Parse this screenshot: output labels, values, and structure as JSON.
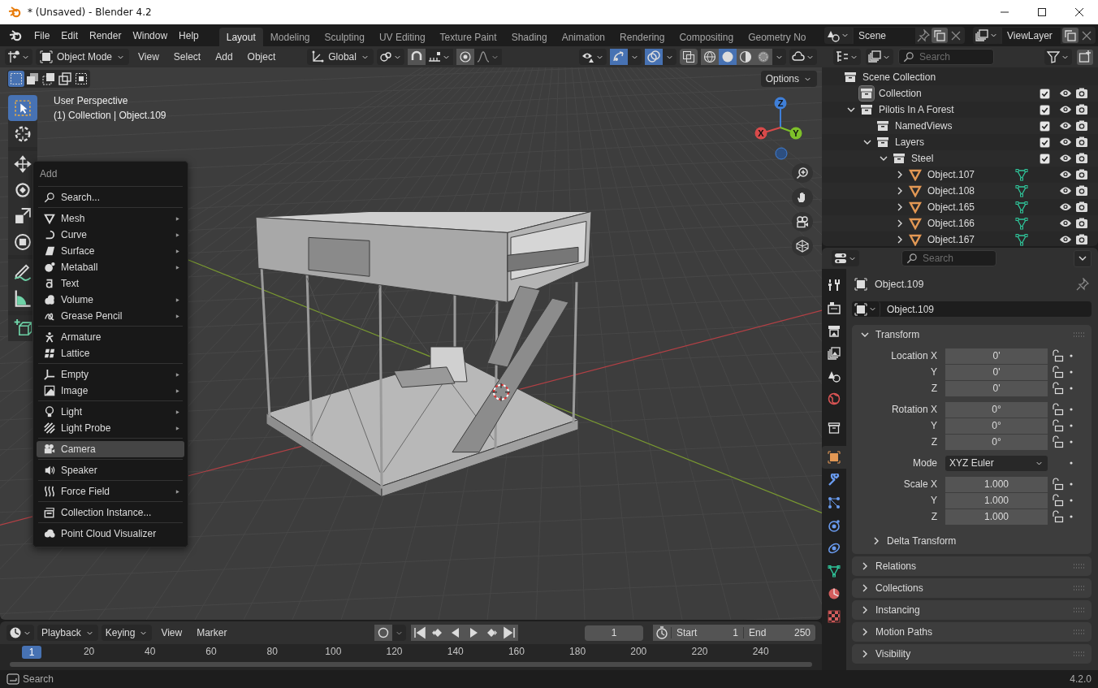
{
  "window": {
    "title": "* (Unsaved) - Blender 4.2"
  },
  "menu": [
    "File",
    "Edit",
    "Render",
    "Window",
    "Help"
  ],
  "workspaces": [
    {
      "label": "Layout",
      "selected": true
    },
    {
      "label": "Modeling",
      "selected": false
    },
    {
      "label": "Sculpting",
      "selected": false
    },
    {
      "label": "UV Editing",
      "selected": false
    },
    {
      "label": "Texture Paint",
      "selected": false
    },
    {
      "label": "Shading",
      "selected": false
    },
    {
      "label": "Animation",
      "selected": false
    },
    {
      "label": "Rendering",
      "selected": false
    },
    {
      "label": "Compositing",
      "selected": false
    },
    {
      "label": "Geometry No",
      "selected": false
    }
  ],
  "scene": {
    "name": "Scene"
  },
  "view_layer": {
    "name": "ViewLayer"
  },
  "viewport_header": {
    "mode": "Object Mode",
    "menus": [
      "View",
      "Select",
      "Add",
      "Object"
    ],
    "orientation": "Global",
    "gizmos_on": true,
    "overlays_on": true,
    "xray_on": false,
    "shading": [
      {
        "selected": false
      },
      {
        "selected": true
      },
      {
        "selected": false
      },
      {
        "selected": false
      }
    ]
  },
  "select_modes": [
    {
      "selected": true
    },
    {
      "selected": false
    },
    {
      "selected": false
    },
    {
      "selected": false
    },
    {
      "selected": false
    }
  ],
  "options": "Options",
  "tools": [
    {
      "kind": "select",
      "selected": true
    },
    {
      "kind": "cursor",
      "selected": false
    },
    {
      "kind": "move",
      "selected": false
    },
    {
      "kind": "rotate",
      "selected": false
    },
    {
      "kind": "scale",
      "selected": false
    },
    {
      "kind": "transform",
      "selected": false
    },
    {
      "kind": "annotate",
      "selected": false
    },
    {
      "kind": "measure",
      "selected": false
    },
    {
      "kind": "addcube",
      "selected": false
    }
  ],
  "viewport_info": {
    "perspective": "User Perspective",
    "context": "(1) Collection | Object.109"
  },
  "gizmo": {
    "z": "Z",
    "x": "X",
    "y": "Y"
  },
  "add_menu": {
    "title": "Add",
    "groups": [
      [
        {
          "kind": "search",
          "label": "Search...",
          "submenu": false,
          "selected": false
        }
      ],
      [
        {
          "kind": "mesh",
          "label": "Mesh",
          "submenu": true,
          "selected": false
        },
        {
          "kind": "curve",
          "label": "Curve",
          "submenu": true,
          "selected": false
        },
        {
          "kind": "surface",
          "label": "Surface",
          "submenu": true,
          "selected": false
        },
        {
          "kind": "metaball",
          "label": "Metaball",
          "submenu": true,
          "selected": false
        },
        {
          "kind": "text",
          "label": "Text",
          "submenu": false,
          "selected": false
        },
        {
          "kind": "volume",
          "label": "Volume",
          "submenu": true,
          "selected": false
        },
        {
          "kind": "grease",
          "label": "Grease Pencil",
          "submenu": true,
          "selected": false
        }
      ],
      [
        {
          "kind": "armature",
          "label": "Armature",
          "submenu": false,
          "selected": false
        },
        {
          "kind": "lattice",
          "label": "Lattice",
          "submenu": false,
          "selected": false
        }
      ],
      [
        {
          "kind": "empty",
          "label": "Empty",
          "submenu": true,
          "selected": false
        },
        {
          "kind": "image",
          "label": "Image",
          "submenu": true,
          "selected": false
        }
      ],
      [
        {
          "kind": "light",
          "label": "Light",
          "submenu": true,
          "selected": false
        },
        {
          "kind": "probe",
          "label": "Light Probe",
          "submenu": true,
          "selected": false
        }
      ],
      [
        {
          "kind": "camera",
          "label": "Camera",
          "submenu": false,
          "selected": true
        }
      ],
      [
        {
          "kind": "speaker",
          "label": "Speaker",
          "submenu": false,
          "selected": false
        }
      ],
      [
        {
          "kind": "force",
          "label": "Force Field",
          "submenu": true,
          "selected": false
        }
      ],
      [
        {
          "kind": "instance",
          "label": "Collection Instance...",
          "submenu": false,
          "selected": false
        }
      ],
      [
        {
          "kind": "cloud",
          "label": "Point Cloud Visualizer",
          "submenu": false,
          "selected": false
        }
      ]
    ]
  },
  "outliner": {
    "search_placeholder": "Search",
    "tree": [
      {
        "kind": "collection",
        "label": "Scene Collection",
        "children": [
          {
            "kind": "collection",
            "label": "Collection",
            "active": true,
            "checked": true
          },
          {
            "kind": "collection",
            "label": "Pilotis In A Forest",
            "expanded": true,
            "checked": true,
            "children": [
              {
                "kind": "collection",
                "label": "NamedViews",
                "checked": true
              },
              {
                "kind": "collection",
                "label": "Layers",
                "expanded": true,
                "checked": true,
                "children": [
                  {
                    "kind": "collection",
                    "label": "Steel",
                    "expanded": true,
                    "checked": true,
                    "children": [
                      {
                        "kind": "object",
                        "label": "Object.107",
                        "expanded": false
                      },
                      {
                        "kind": "object",
                        "label": "Object.108",
                        "expanded": false
                      },
                      {
                        "kind": "object",
                        "label": "Object.165",
                        "expanded": false
                      },
                      {
                        "kind": "object",
                        "label": "Object.166",
                        "expanded": false
                      },
                      {
                        "kind": "object",
                        "label": "Object.167",
                        "expanded": false
                      }
                    ]
                  }
                ]
              }
            ]
          }
        ]
      }
    ]
  },
  "properties": {
    "search_placeholder": "Search",
    "tabs": [
      {
        "kind": "tool",
        "selected": false
      },
      {
        "kind": "render",
        "selected": false
      },
      {
        "kind": "output",
        "selected": false
      },
      {
        "kind": "viewlayer",
        "selected": false
      },
      {
        "kind": "scene",
        "selected": false
      },
      {
        "kind": "world",
        "selected": false
      },
      {
        "kind": "collection",
        "selected": false
      },
      {
        "kind": "object",
        "selected": true
      },
      {
        "kind": "modifier",
        "selected": false
      },
      {
        "kind": "particles",
        "selected": false
      },
      {
        "kind": "physics",
        "selected": false
      },
      {
        "kind": "constraints",
        "selected": false
      },
      {
        "kind": "data",
        "selected": false
      },
      {
        "kind": "material",
        "selected": false
      },
      {
        "kind": "texture",
        "selected": false
      }
    ],
    "object_name": "Object.109",
    "datablock": "Object.109",
    "transform": {
      "label": "Transform",
      "expanded": true,
      "groups": [
        [
          {
            "kind": "number",
            "label": "Location X",
            "value": "0'",
            "locked": false
          },
          {
            "kind": "number",
            "label": "Y",
            "value": "0'",
            "locked": false
          },
          {
            "kind": "number",
            "label": "Z",
            "value": "0'",
            "locked": false
          }
        ],
        [
          {
            "kind": "number",
            "label": "Rotation X",
            "value": "0°",
            "locked": false
          },
          {
            "kind": "number",
            "label": "Y",
            "value": "0°",
            "locked": false
          },
          {
            "kind": "number",
            "label": "Z",
            "value": "0°",
            "locked": false
          }
        ],
        [
          {
            "kind": "dropdown",
            "label": "Mode",
            "value": "XYZ Euler"
          }
        ],
        [
          {
            "kind": "number",
            "label": "Scale X",
            "value": "1.000",
            "locked": false
          },
          {
            "kind": "number",
            "label": "Y",
            "value": "1.000",
            "locked": false
          },
          {
            "kind": "number",
            "label": "Z",
            "value": "1.000",
            "locked": false
          }
        ]
      ],
      "subpanel": {
        "label": "Delta Transform",
        "expanded": false
      }
    },
    "panels": [
      {
        "label": "Relations",
        "expanded": false
      },
      {
        "label": "Collections",
        "expanded": false
      },
      {
        "label": "Instancing",
        "expanded": false
      },
      {
        "label": "Motion Paths",
        "expanded": false
      },
      {
        "label": "Visibility",
        "expanded": false
      }
    ]
  },
  "timeline": {
    "menus": [
      "Playback",
      "Keying",
      "View",
      "Marker"
    ],
    "current_frame": "1",
    "start_label": "Start",
    "start": "1",
    "end_label": "End",
    "end": "250",
    "playhead": "1",
    "ticks": [
      "20",
      "40",
      "60",
      "80",
      "100",
      "120",
      "140",
      "160",
      "180",
      "200",
      "220",
      "240"
    ]
  },
  "status_bar": {
    "search": "Search",
    "version": "4.2.0"
  }
}
